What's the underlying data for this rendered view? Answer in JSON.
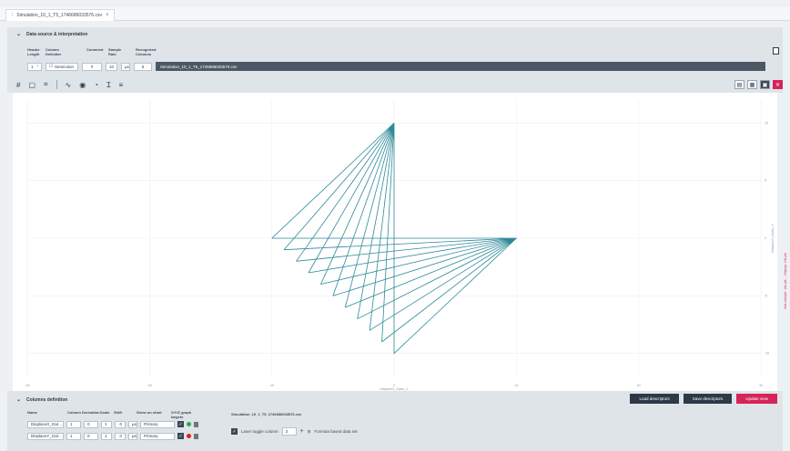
{
  "tab": {
    "title": "Simulation_10_1_T5_1746686033576.csv",
    "close": "×"
  },
  "data_source": {
    "title": "Data source & interpretation",
    "labels": {
      "header_length": [
        "Header",
        "Length"
      ],
      "column_delimiter": [
        "Column",
        "Delimiter"
      ],
      "comment": [
        "Comment"
      ],
      "sample_rate": [
        "Sample",
        "Rate"
      ],
      "recognized_columns": [
        "Recognized",
        "Columns"
      ]
    },
    "header_length": "1",
    "delimiter": "Semicolon",
    "comment": "#",
    "sample_rate": "10",
    "sample_unit": "µs",
    "recognized_columns": "5",
    "filename": "Simulation_10_1_T5_1746686033576.csv"
  },
  "chart_data": {
    "type": "line",
    "xlabel": "DisplaceX_Galvo_X",
    "ylabel": "DisplaceY_Galvo_Y",
    "xlim": [
      -30,
      30
    ],
    "ylim": [
      -12,
      12
    ],
    "x_ticks": [
      -30,
      -20,
      -10,
      0,
      10,
      20,
      30
    ],
    "y_ticks": [
      10,
      5,
      0,
      -5,
      -10
    ],
    "series": [
      {
        "color": "#2e8a99",
        "points": [
          [
            0,
            10
          ],
          [
            -10,
            0
          ],
          [
            0,
            10
          ],
          [
            -9,
            -1
          ],
          [
            0,
            10
          ],
          [
            -8,
            -2
          ],
          [
            0,
            10
          ],
          [
            -7,
            -3
          ],
          [
            0,
            10
          ],
          [
            -6,
            -4
          ],
          [
            0,
            10
          ],
          [
            -5,
            -5
          ],
          [
            0,
            10
          ],
          [
            -4,
            -6
          ],
          [
            0,
            10
          ],
          [
            -3,
            -7
          ],
          [
            0,
            10
          ],
          [
            -2,
            -8
          ],
          [
            0,
            10
          ],
          [
            -1,
            -9
          ],
          [
            0,
            10
          ],
          [
            0,
            -10
          ],
          [
            10,
            0
          ],
          [
            -10,
            0
          ],
          [
            10,
            0
          ],
          [
            -9,
            -1
          ],
          [
            10,
            0
          ],
          [
            -8,
            -2
          ],
          [
            10,
            0
          ],
          [
            -7,
            -3
          ],
          [
            10,
            0
          ],
          [
            -6,
            -4
          ],
          [
            10,
            0
          ],
          [
            -5,
            -5
          ],
          [
            10,
            0
          ],
          [
            -4,
            -6
          ],
          [
            10,
            0
          ],
          [
            -3,
            -7
          ],
          [
            10,
            0
          ],
          [
            -2,
            -8
          ],
          [
            10,
            0
          ],
          [
            -1,
            -9
          ],
          [
            10,
            0
          ],
          [
            0,
            -10
          ]
        ]
      }
    ]
  },
  "side_label": "Sub-Sample: 10k pts ... Display: 10k pts",
  "column_definition": {
    "title": "Columns definition",
    "buttons": {
      "load": "Load descriptors",
      "save": "Save descriptors",
      "update": "Update view"
    },
    "headers": {
      "name": "Name",
      "column": "Column",
      "derivation": "Derivation",
      "scale": "Scale",
      "shift": "Shift",
      "show_on_chart": "Show on chart",
      "graph_targets": "X/Y/Z graph targets"
    },
    "file": "Simulation_10_1_T5_1746686033576.csv",
    "rows": [
      {
        "name": "DisplaceX_Gal…",
        "column": "1",
        "derivation": "0",
        "scale": "1",
        "shift": "0",
        "unit": "µs",
        "axis": "Primary",
        "color": "#2ea84a"
      },
      {
        "name": "DisplaceY_Gal…",
        "column": "1",
        "derivation": "0",
        "scale": "1",
        "shift": "0",
        "unit": "µs",
        "axis": "Primary",
        "color": "#e02020"
      }
    ],
    "laser_toggle_label": "Laser toggle column",
    "laser_toggle_value": "3",
    "formula_label": "Formula based data set"
  }
}
